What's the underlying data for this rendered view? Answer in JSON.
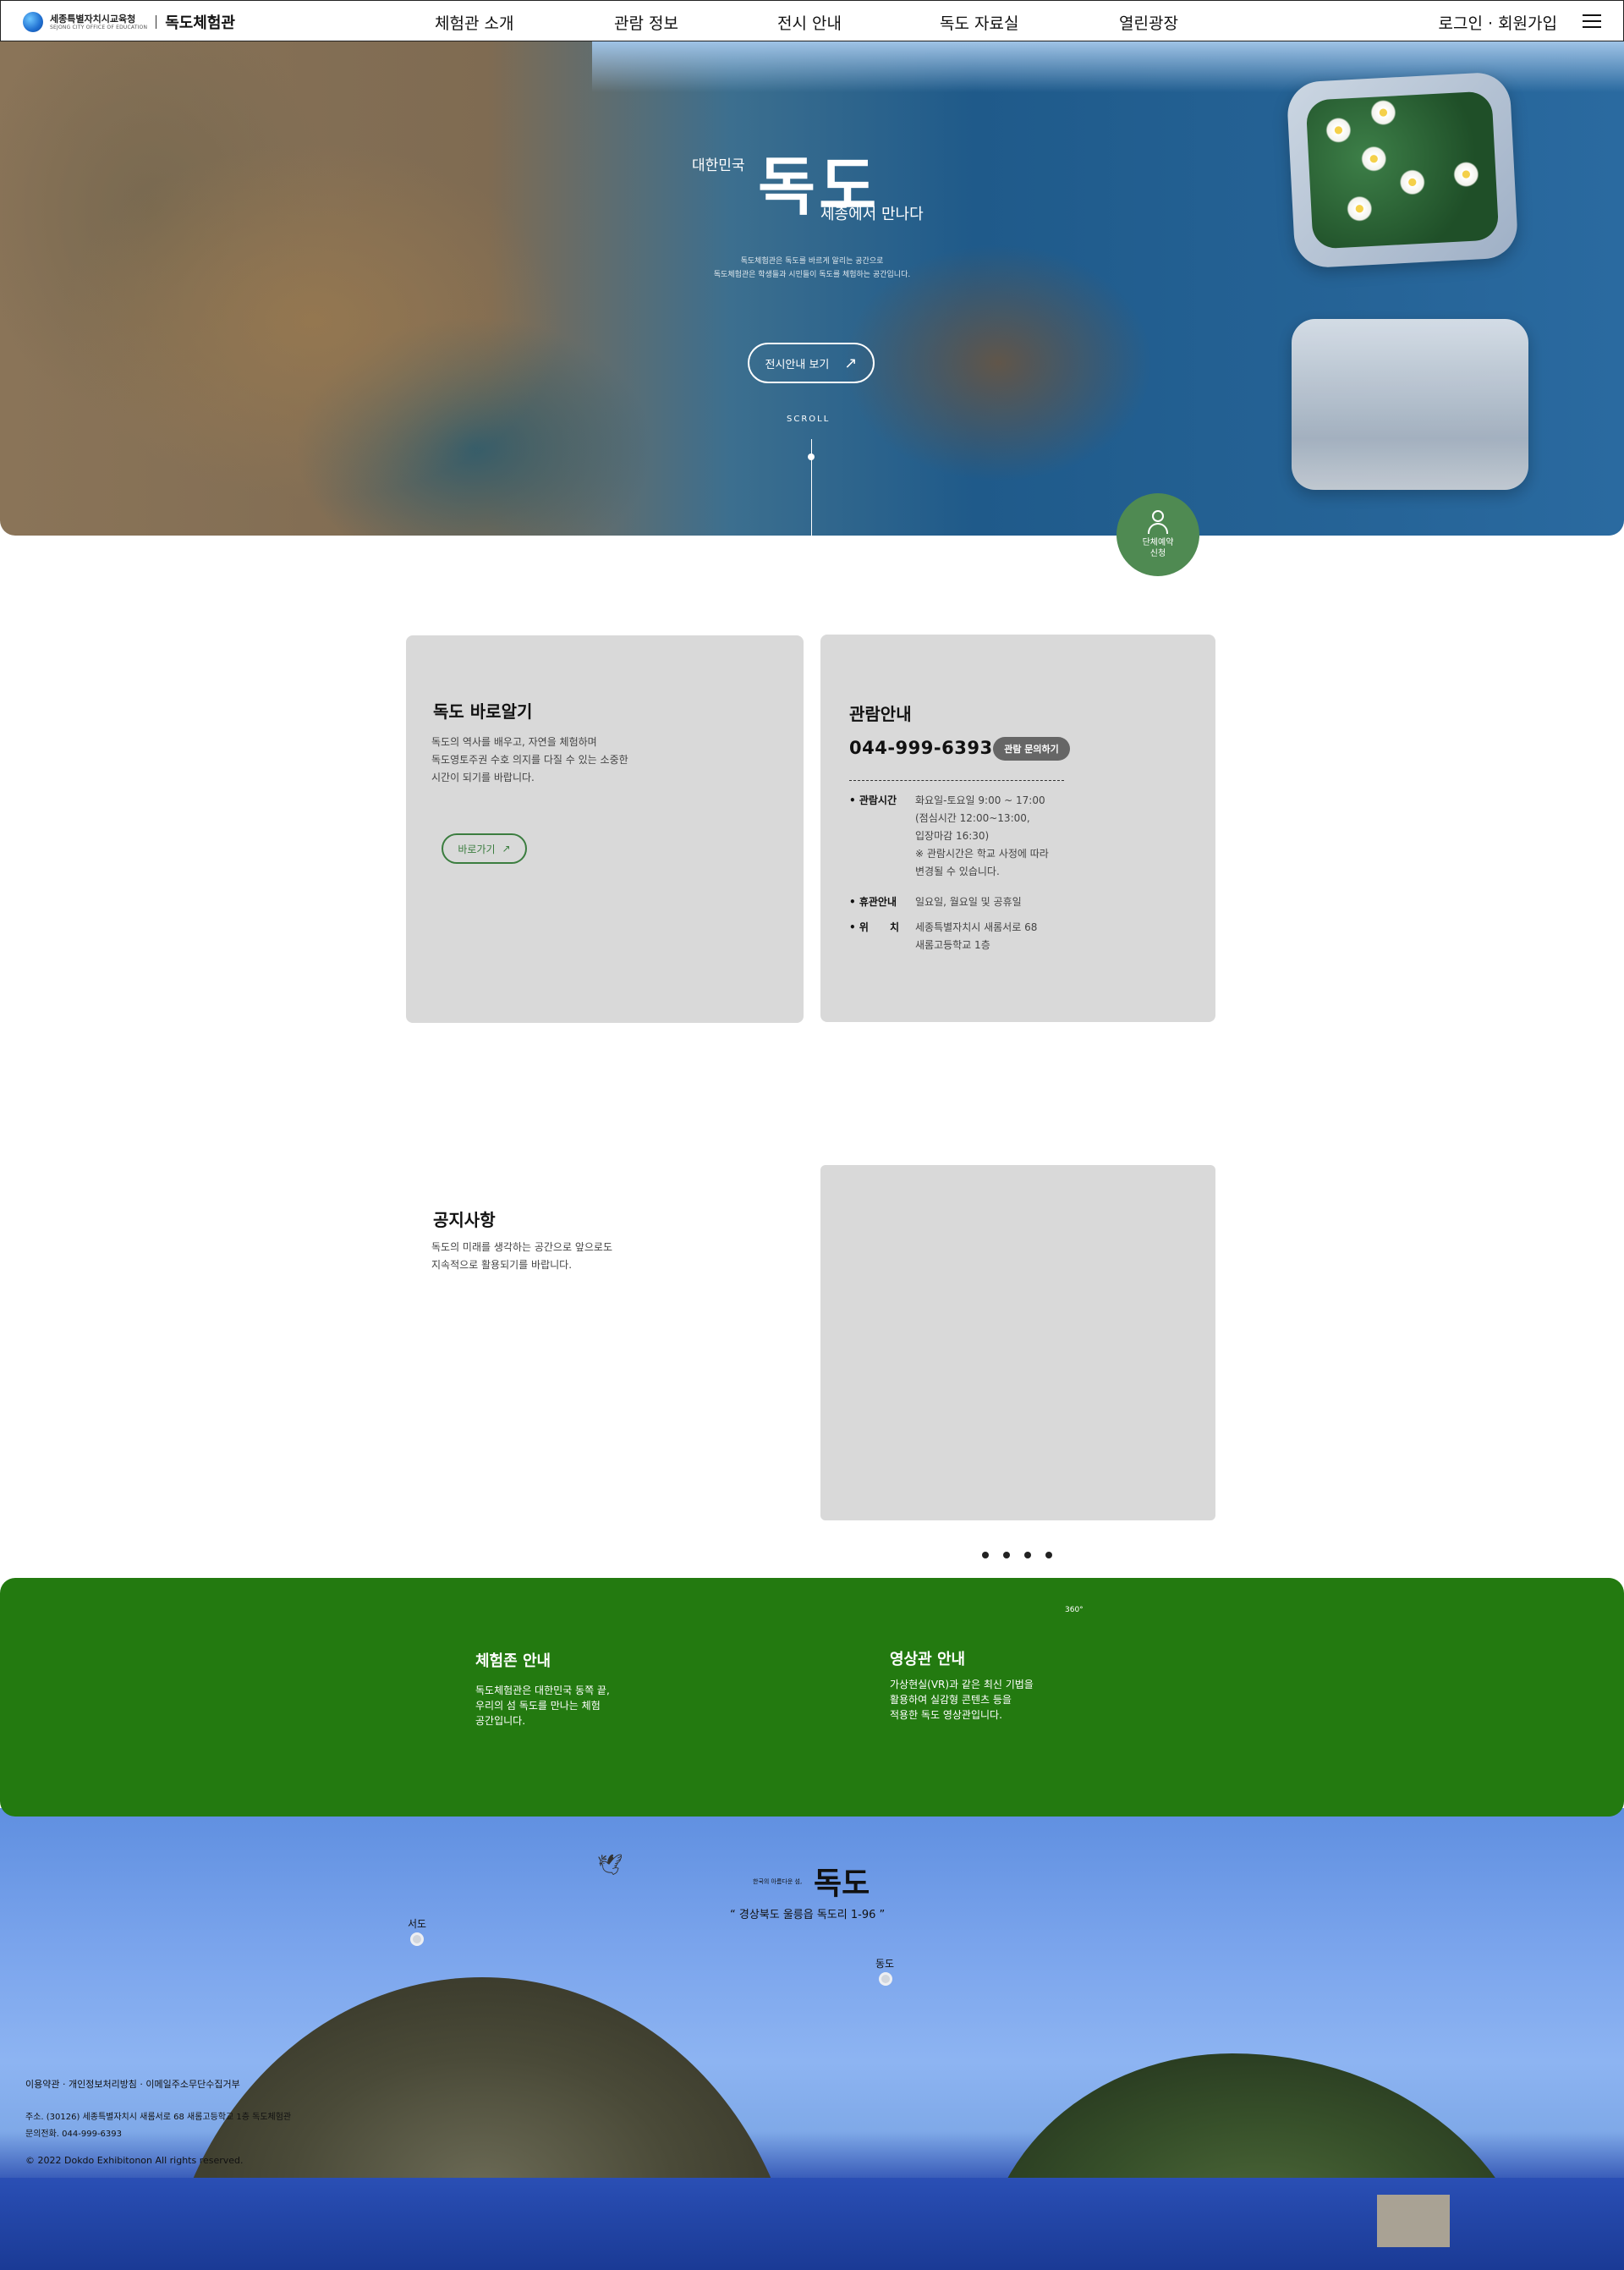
{
  "header": {
    "logo_ko": "세종특별자치시교육청",
    "logo_en": "SEJONG CITY OFFICE OF EDUCATION",
    "site_name": "독도체험관",
    "nav": [
      "체험관 소개",
      "관람 정보",
      "전시 안내",
      "독도 자료실",
      "열린광장"
    ],
    "login": "로그인 · 회원가입"
  },
  "hero": {
    "small_title": "대한민국",
    "big_title": "독도",
    "subtitle": "세종에서 만나다",
    "desc_line1": "독도체험관은 독도를 바르게 알리는 공간으로",
    "desc_line2": "독도체험관은 학생들과 시민들이 독도를 체험하는 공간입니다.",
    "button": "전시안내 보기",
    "scroll": "SCROLL"
  },
  "group_badge": "단체예약\n신청",
  "card_dokdo": {
    "title": "독도 바로알기",
    "text": "독도의 역사를 배우고, 자연을 체험하며\n독도영토주권 수호 의지를 다질 수 있는 소중한\n시간이 되기를 바랍니다.",
    "button": "바로가기"
  },
  "card_info": {
    "title": "관람안내",
    "phone": "044-999-6393",
    "inquiry": "관람 문의하기",
    "rows": [
      {
        "label": "• 관람시간",
        "value": "화요일-토요일 9:00 ~ 17:00\n(점심시간 12:00~13:00,\n입장마감 16:30)\n※ 관람시간은 학교 사정에 따라\n변경될 수 있습니다."
      },
      {
        "label": "• 휴관안내",
        "value": "일요일, 월요일 및 공휴일"
      },
      {
        "label": "• 위      치",
        "value": "세종특별자치시 새롬서로 68\n새롬고등학교 1층"
      }
    ]
  },
  "notice": {
    "title": "공지사항",
    "text": "독도의 미래를 생각하는 공간으로 앞으로도\n지속적으로 활용되기를 바랍니다."
  },
  "green": {
    "zone_title": "체험존 안내",
    "zone_text": "독도체험관은 대한민국 동쪽 끝,\n우리의 섬 독도를 만나는 체험\n공간입니다.",
    "video_title": "영상관 안내",
    "video_text": "가상현실(VR)과 같은 최신 기법을\n활용하여 실감형 콘텐츠 등을\n적용한 독도 영상관입니다.",
    "tag_360": "360°"
  },
  "bottom": {
    "small_title": "한국의 아름다운 섬,",
    "big_title": "독도",
    "address": "“ 경상북도 울릉읍 독도리 1-96 ”",
    "west": "서도",
    "east": "동도"
  },
  "footer": {
    "links": "이용약관 · 개인정보처리방침 · 이메일주소무단수집거부",
    "address": "주소. (30126) 세종특별자치시 새롬서로 68 새롬고등학교 1층 독도체험관\n문의전화. 044-999-6393",
    "copyright": "© 2022 Dokdo Exhibitonon All rights reserved."
  },
  "colors": {
    "green_band": "#237a10",
    "badge_green": "#4f8a52",
    "card_gray": "#d9d9d9",
    "accent_outline": "#3b7d3f"
  }
}
